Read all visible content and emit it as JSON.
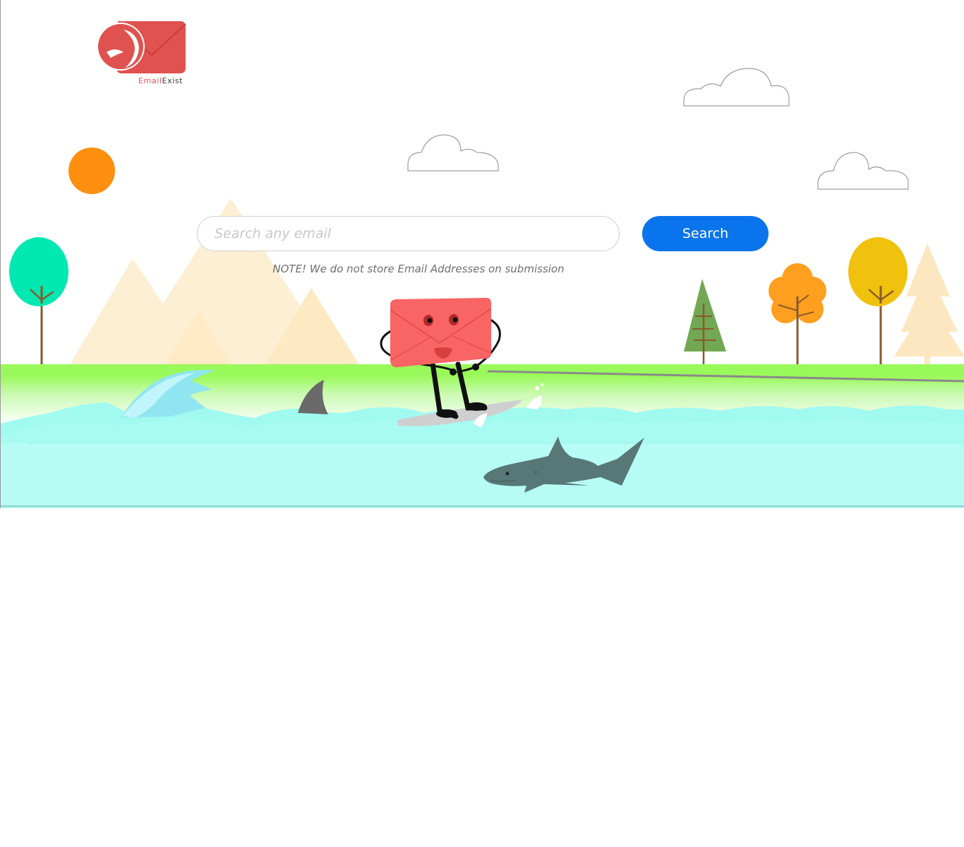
{
  "brand": {
    "word1": "Email",
    "word2": "Exist",
    "primary_color": "#e0524f",
    "icon": "envelope-logo-icon"
  },
  "search": {
    "placeholder": "Search any email",
    "value": "",
    "button_label": "Search",
    "button_color": "#0a74ec"
  },
  "note": "NOTE! We do not store Email Addresses on submission",
  "scene": {
    "sun_color": "#ff8f0f",
    "grass_color": "#9af95a",
    "water_color": "#b6fcf5",
    "mascot": "envelope-surfer-icon",
    "predator": "shark-icon"
  }
}
